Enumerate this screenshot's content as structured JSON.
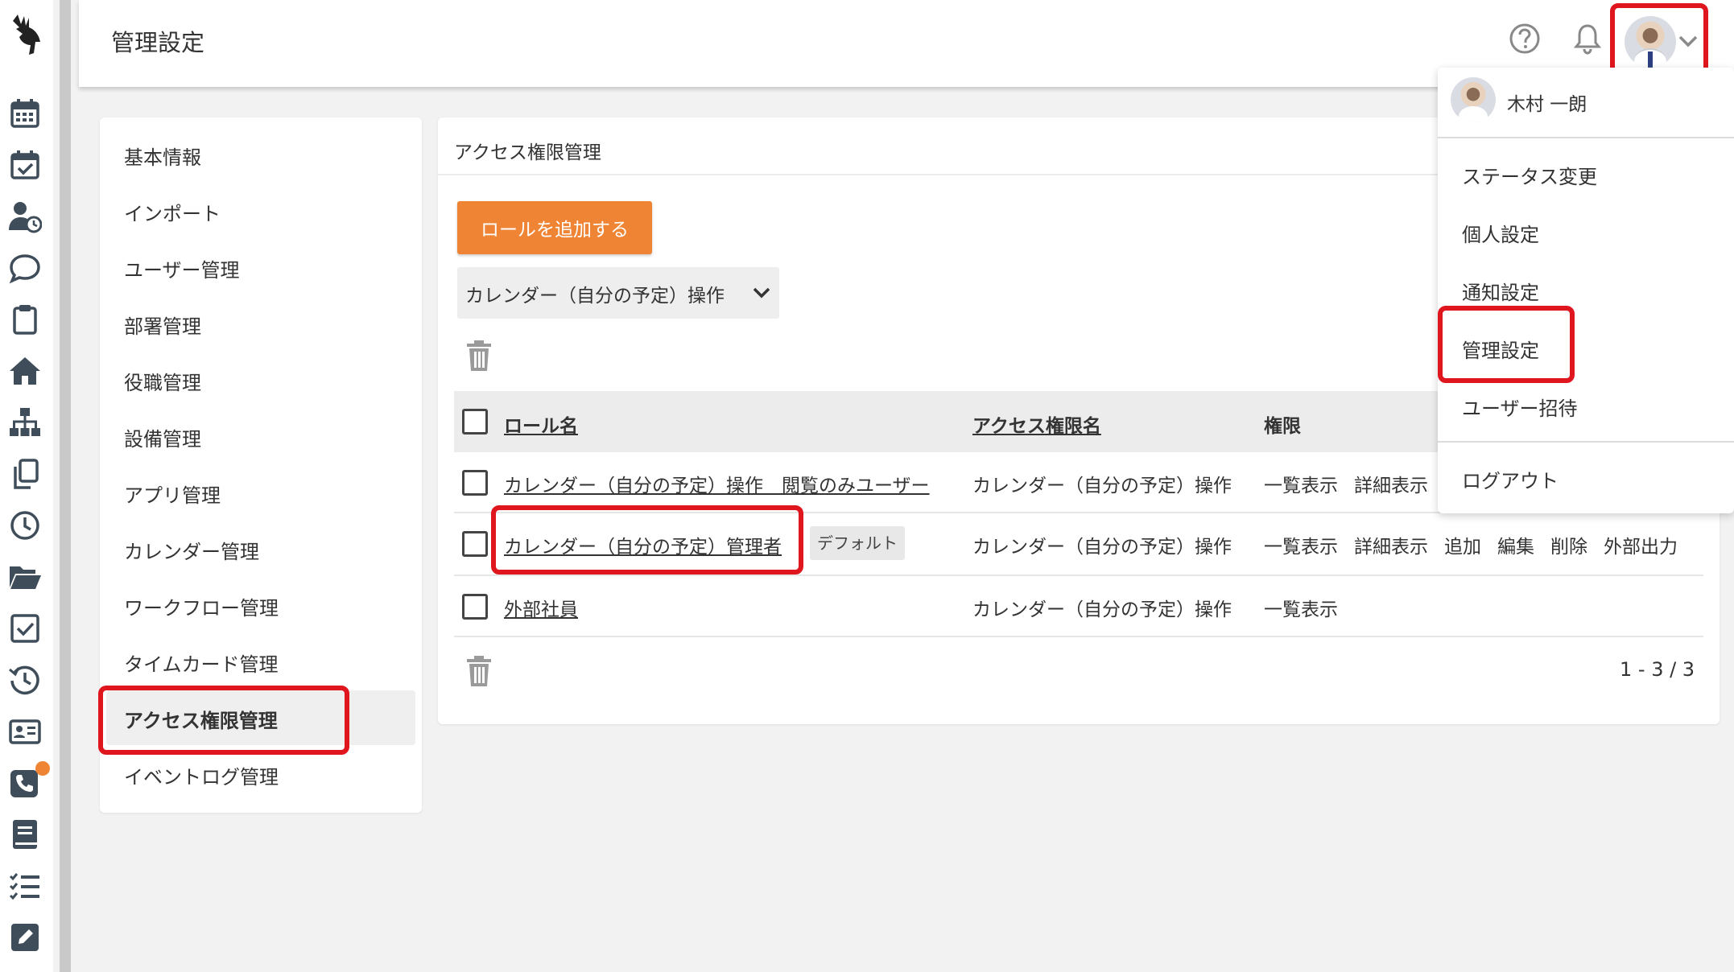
{
  "header": {
    "title": "管理設定",
    "help_icon": "help-circle-icon",
    "notification_icon": "bell-icon"
  },
  "sidebar_icons": [
    "calendar-icon",
    "calendar-check-icon",
    "user-clock-icon",
    "chat-bubble-icon",
    "clipboard-icon",
    "home-icon",
    "org-chart-icon",
    "copy-icon",
    "clock-icon",
    "folder-open-icon",
    "checkbox-icon",
    "history-icon",
    "id-card-icon",
    "phone-icon",
    "book-icon",
    "checklist-icon",
    "edit-icon"
  ],
  "settings_nav": {
    "items": [
      "基本情報",
      "インポート",
      "ユーザー管理",
      "部署管理",
      "役職管理",
      "設備管理",
      "アプリ管理",
      "カレンダー管理",
      "ワークフロー管理",
      "タイムカード管理",
      "アクセス権限管理",
      "イベントログ管理"
    ],
    "active_index": 10
  },
  "panel": {
    "title": "アクセス権限管理",
    "add_button": "ロールを追加する",
    "filter_select": "カレンダー（自分の予定）操作",
    "columns": [
      "ロール名",
      "アクセス権限名",
      "権限"
    ],
    "rows": [
      {
        "role": "カレンダー（自分の予定）操作　閲覧のみユーザー",
        "tag": "",
        "access": "カレンダー（自分の予定）操作",
        "permissions": [
          "一覧表示",
          "詳細表示"
        ]
      },
      {
        "role": "カレンダー（自分の予定）管理者",
        "tag": "デフォルト",
        "access": "カレンダー（自分の予定）操作",
        "permissions": [
          "一覧表示",
          "詳細表示",
          "追加",
          "編集",
          "削除",
          "外部出力"
        ]
      },
      {
        "role": "外部社員",
        "tag": "",
        "access": "カレンダー（自分の予定）操作",
        "permissions": [
          "一覧表示"
        ]
      }
    ],
    "pagination": "1 - 3 / 3"
  },
  "user_menu": {
    "name": "木村 一朗",
    "items": [
      "ステータス変更",
      "個人設定",
      "通知設定",
      "管理設定",
      "ユーザー招待",
      "ログアウト"
    ]
  },
  "colors": {
    "accent": "#ef8434",
    "highlight": "#e0161e",
    "icon_rail": "#3f4d5a"
  }
}
